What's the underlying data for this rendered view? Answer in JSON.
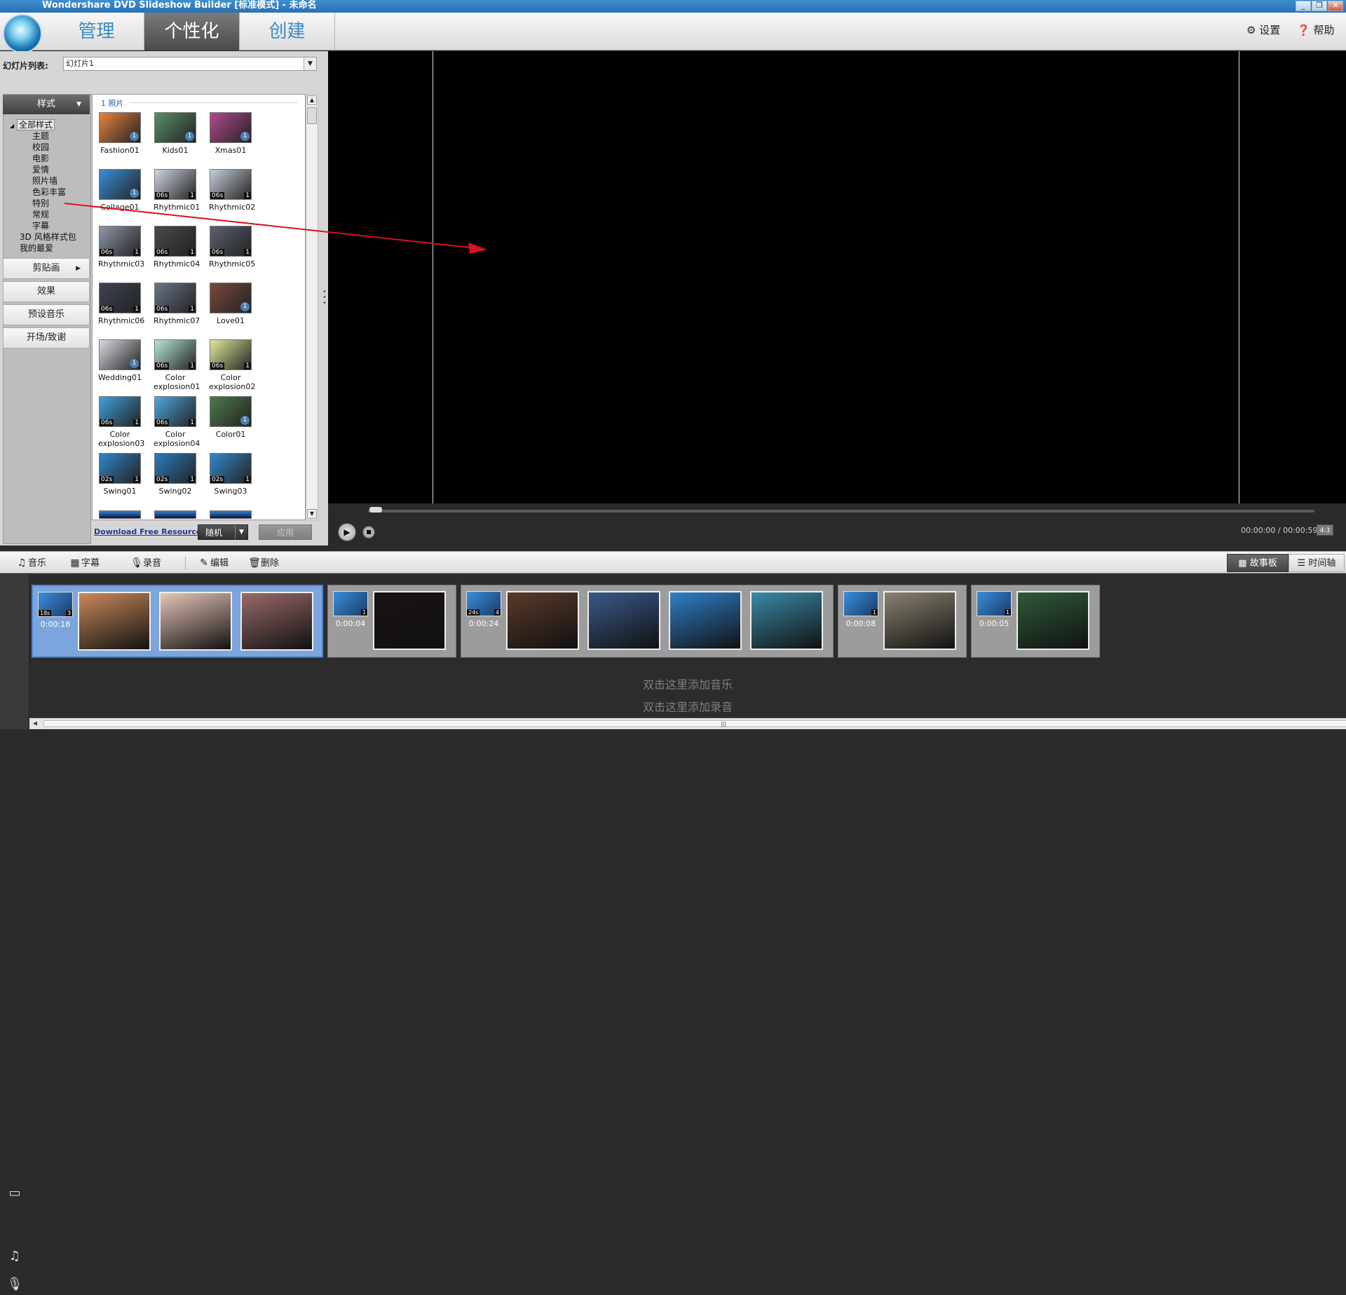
{
  "window": {
    "title": "Wondershare DVD Slideshow Builder [标准模式] - 未命名",
    "controls": [
      "_",
      "❐",
      "✕"
    ]
  },
  "topbar": {
    "tabs": [
      {
        "label": "管理",
        "active": false
      },
      {
        "label": "个性化",
        "active": true
      },
      {
        "label": "创建",
        "active": false
      }
    ],
    "settings_label": "设置",
    "help_label": "帮助"
  },
  "slidelist": {
    "label": "幻灯片列表:",
    "value": "幻灯片1"
  },
  "categories": {
    "header": "样式",
    "tree": [
      "全部样式",
      "主题",
      "校园",
      "电影",
      "爱情",
      "照片墙",
      "色彩丰富",
      "特别",
      "常规",
      "字幕",
      "3D 风格样式包",
      "我的最爱"
    ],
    "buttons": [
      "剪贴画",
      "效果",
      "预设音乐",
      "开场/致谢"
    ]
  },
  "styles": {
    "group_label": "1 照片",
    "items": [
      {
        "name": "Fashion01",
        "color": "#e8843a",
        "dur": "",
        "count": "",
        "badge": "1"
      },
      {
        "name": "Kids01",
        "color": "#5a8f6a",
        "dur": "",
        "count": "",
        "badge": "1"
      },
      {
        "name": "Xmas01",
        "color": "#b34a8e",
        "dur": "",
        "count": "",
        "badge": "1"
      },
      {
        "name": "Collage01",
        "color": "#3a8fd8",
        "dur": "",
        "count": "",
        "badge": "1"
      },
      {
        "name": "Rhythmic01",
        "color": "#cfd6e3",
        "dur": "06s",
        "count": "1",
        "badge": ""
      },
      {
        "name": "Rhythmic02",
        "color": "#c6ced9",
        "dur": "06s",
        "count": "1",
        "badge": ""
      },
      {
        "name": "Rhythmic03",
        "color": "#8d97a8",
        "dur": "06s",
        "count": "1",
        "badge": ""
      },
      {
        "name": "Rhythmic04",
        "color": "#4a4a4a",
        "dur": "06s",
        "count": "1",
        "badge": ""
      },
      {
        "name": "Rhythmic05",
        "color": "#5a6270",
        "dur": "06s",
        "count": "1",
        "badge": ""
      },
      {
        "name": "Rhythmic06",
        "color": "#3c4452",
        "dur": "06s",
        "count": "1",
        "badge": ""
      },
      {
        "name": "Rhythmic07",
        "color": "#6a7585",
        "dur": "06s",
        "count": "1",
        "badge": ""
      },
      {
        "name": "Love01",
        "color": "#7a4a3c",
        "dur": "",
        "count": "",
        "badge": "1"
      },
      {
        "name": "Wedding01",
        "color": "#d8dbe3",
        "dur": "",
        "count": "",
        "badge": "1"
      },
      {
        "name": "Color explosion01",
        "color": "#b7e6d6",
        "dur": "06s",
        "count": "1",
        "badge": ""
      },
      {
        "name": "Color explosion02",
        "color": "#e2ea9a",
        "dur": "06s",
        "count": "1",
        "badge": ""
      },
      {
        "name": "Color explosion03",
        "color": "#3ea0dc",
        "dur": "06s",
        "count": "1",
        "badge": ""
      },
      {
        "name": "Color explosion04",
        "color": "#4ba8df",
        "dur": "06s",
        "count": "1",
        "badge": ""
      },
      {
        "name": "Color01",
        "color": "#4d7a4a",
        "dur": "",
        "count": "",
        "badge": "1"
      },
      {
        "name": "Swing01",
        "color": "#2f86c8",
        "dur": "02s",
        "count": "1",
        "badge": ""
      },
      {
        "name": "Swing02",
        "color": "#2a7dbf",
        "dur": "02s",
        "count": "1",
        "badge": ""
      },
      {
        "name": "Swing03",
        "color": "#3389cb",
        "dur": "02s",
        "count": "1",
        "badge": ""
      }
    ]
  },
  "panel_bottom": {
    "download_link": "Download Free Resource",
    "random_label": "随机",
    "apply_label": "应用"
  },
  "player": {
    "time": "00:00:00 / 00:00:59",
    "aspect": "4:3",
    "progress": 0
  },
  "toolbar": {
    "music": "音乐",
    "caption": "字幕",
    "record": "录音",
    "edit": "编辑",
    "delete": "删除",
    "storyboard": "故事板",
    "timeline": "时间轴"
  },
  "storyboard": {
    "groups": [
      {
        "duration": "0:00:18",
        "mini_dur": "18s",
        "mini_count": "3",
        "selected": true,
        "colors": [
          "#c98a5a",
          "#e7c6b8",
          "#9a6a6a"
        ]
      },
      {
        "duration": "0:00:04",
        "mini_dur": "",
        "mini_count": "1",
        "selected": false,
        "colors": [
          "#1a1212"
        ]
      },
      {
        "duration": "0:00:24",
        "mini_dur": "24s",
        "mini_count": "4",
        "selected": false,
        "colors": [
          "#5a3a2a",
          "#3a5a8a",
          "#2f7fc9",
          "#3a8aa8"
        ]
      },
      {
        "duration": "0:00:08",
        "mini_dur": "",
        "mini_count": "1",
        "selected": false,
        "colors": [
          "#8a8270"
        ]
      },
      {
        "duration": "0:00:05",
        "mini_dur": "",
        "mini_count": "1",
        "selected": false,
        "colors": [
          "#2f5a3a"
        ]
      }
    ],
    "add_music": "双击这里添加音乐",
    "add_record": "双击这里添加录音"
  }
}
